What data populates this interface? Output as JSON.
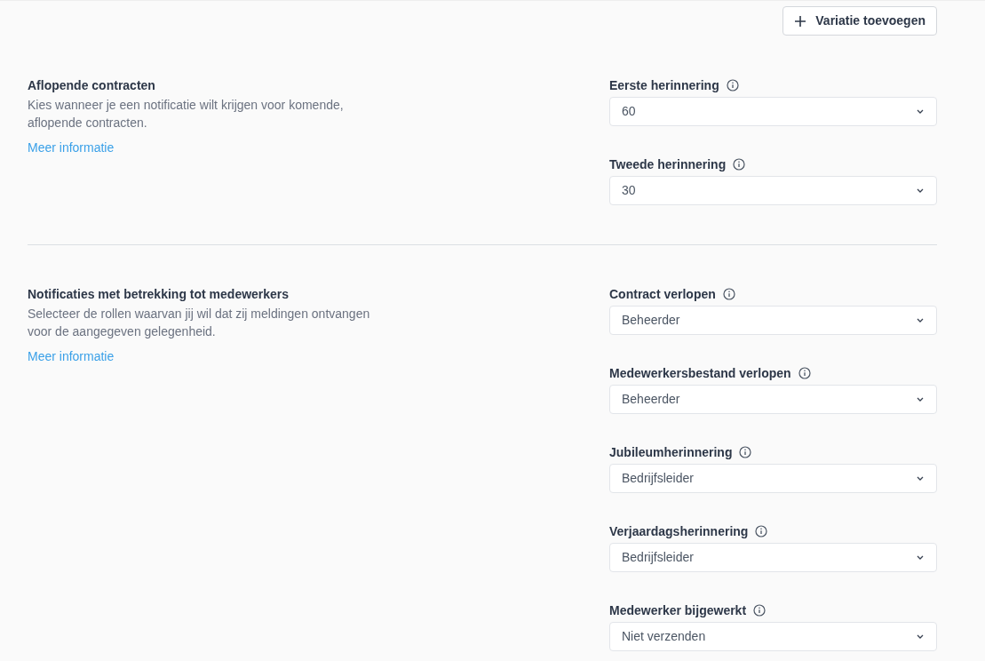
{
  "add_button": {
    "label": "Variatie toevoegen"
  },
  "sections": [
    {
      "title": "Aflopende contracten",
      "description": "Kies wanneer je een notificatie wilt krijgen voor komende, aflopende contracten.",
      "link": "Meer informatie",
      "fields": [
        {
          "label": "Eerste herinnering",
          "value": "60"
        },
        {
          "label": "Tweede herinnering",
          "value": "30"
        }
      ]
    },
    {
      "title": "Notificaties met betrekking tot medewerkers",
      "description": "Selecteer de rollen waarvan jij wil dat zij meldingen ontvangen voor de aangegeven gelegenheid.",
      "link": "Meer informatie",
      "fields": [
        {
          "label": "Contract verlopen",
          "value": "Beheerder"
        },
        {
          "label": "Medewerkersbestand verlopen",
          "value": "Beheerder"
        },
        {
          "label": "Jubileumherinnering",
          "value": "Bedrijfsleider"
        },
        {
          "label": "Verjaardagsherinnering",
          "value": "Bedrijfsleider"
        },
        {
          "label": "Medewerker bijgewerkt",
          "value": "Niet verzenden"
        }
      ]
    }
  ]
}
